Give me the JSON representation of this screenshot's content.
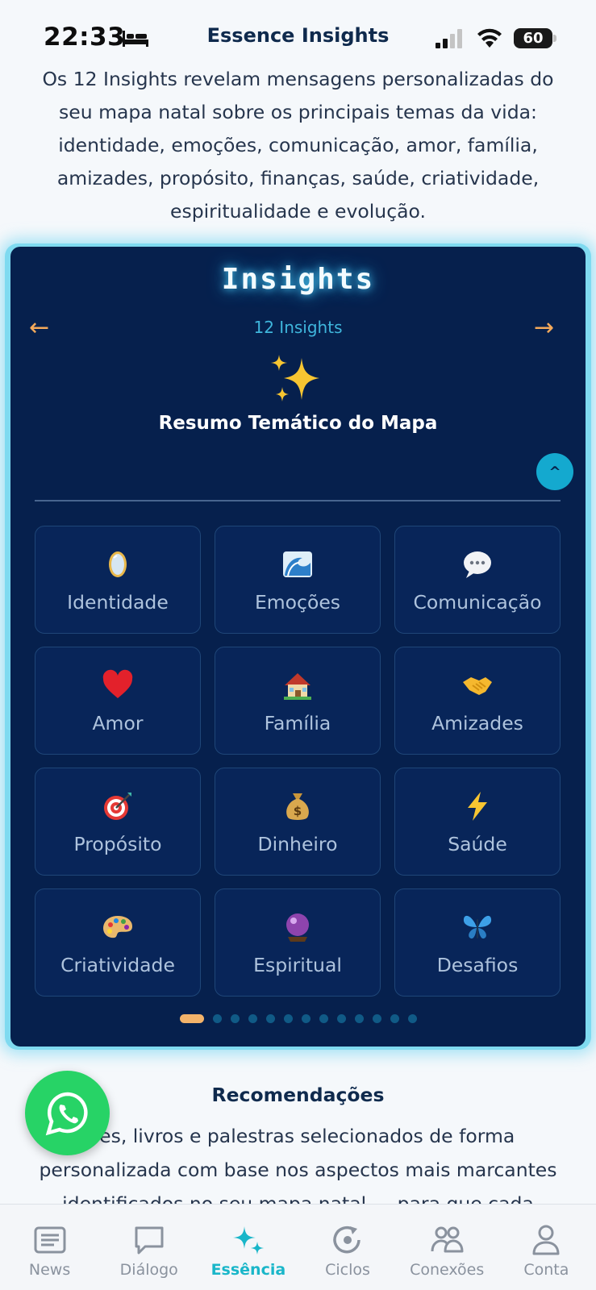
{
  "status_bar": {
    "time": "22:33",
    "battery": "60"
  },
  "header": {
    "title": "Essence Insights"
  },
  "intro": {
    "text": "Os 12 Insights revelam mensagens personalizadas do seu mapa natal sobre os principais temas da vida: identidade, emoções, comunicação, amor, família, amizades, propósito, finanças, saúde, criatividade, espiritualidade e evolução."
  },
  "insights": {
    "title": "Insights",
    "prev": "←",
    "next": "→",
    "count": "12 Insights",
    "section_title": "Resumo Temático do Mapa",
    "collapse": "^",
    "tiles": [
      {
        "label": "Identidade",
        "icon": "mirror-icon"
      },
      {
        "label": "Emoções",
        "icon": "wave-icon"
      },
      {
        "label": "Comunicação",
        "icon": "speech-bubble-icon"
      },
      {
        "label": "Amor",
        "icon": "heart-icon"
      },
      {
        "label": "Família",
        "icon": "house-icon"
      },
      {
        "label": "Amizades",
        "icon": "handshake-icon"
      },
      {
        "label": "Propósito",
        "icon": "target-icon"
      },
      {
        "label": "Dinheiro",
        "icon": "money-bag-icon"
      },
      {
        "label": "Saúde",
        "icon": "lightning-icon"
      },
      {
        "label": "Criatividade",
        "icon": "palette-icon"
      },
      {
        "label": "Espiritual",
        "icon": "crystal-ball-icon"
      },
      {
        "label": "Desafios",
        "icon": "butterfly-icon"
      }
    ],
    "pagination": {
      "total": 13,
      "active": 1
    }
  },
  "recommendations": {
    "title": "Recomendações",
    "text": "...es, livros e palestras selecionados de forma personalizada com base nos aspectos mais marcantes identificados no seu mapa natal — para que cada"
  },
  "nav": {
    "items": [
      {
        "label": "News",
        "icon": "newspaper-icon",
        "active": false
      },
      {
        "label": "Diálogo",
        "icon": "chat-icon",
        "active": false
      },
      {
        "label": "Essência",
        "icon": "sparkles-icon",
        "active": true
      },
      {
        "label": "Ciclos",
        "icon": "cycle-icon",
        "active": false
      },
      {
        "label": "Conexões",
        "icon": "people-icon",
        "active": false
      },
      {
        "label": "Conta",
        "icon": "person-icon",
        "active": false
      }
    ]
  },
  "colors": {
    "card": "#06204d",
    "accent": "#19b6c9",
    "arrow": "#f3a95b",
    "whatsapp": "#27d366"
  }
}
